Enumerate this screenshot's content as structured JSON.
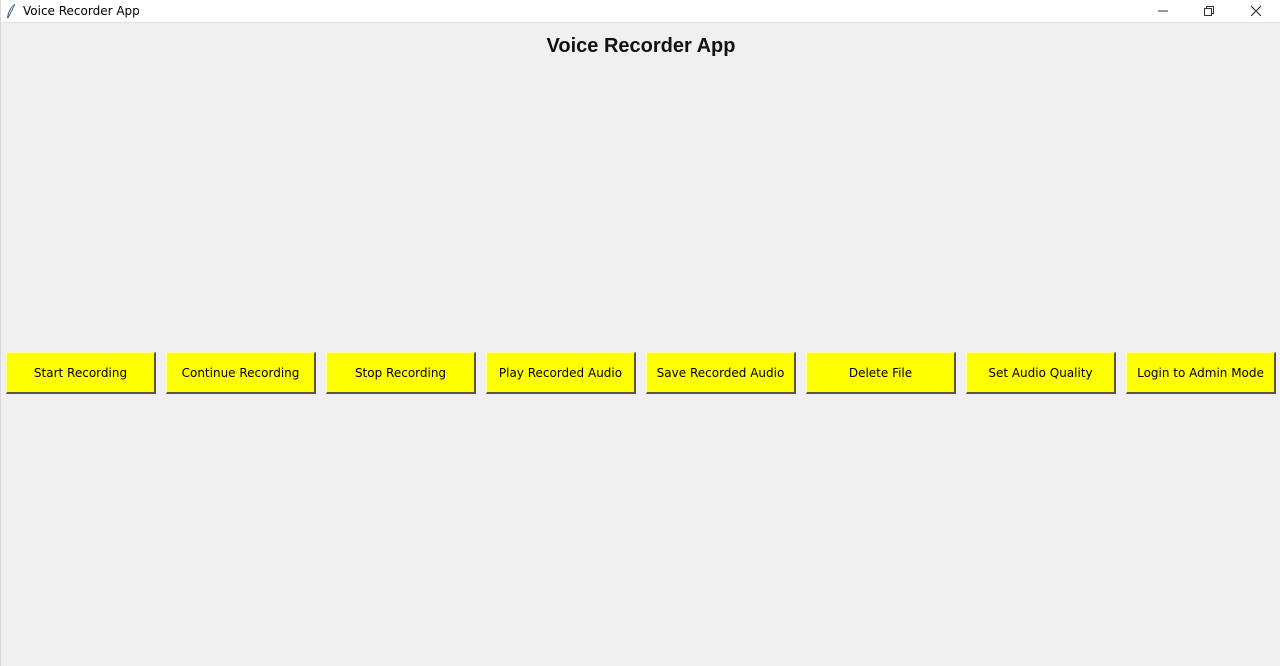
{
  "window": {
    "title": "Voice Recorder App",
    "app_icon": "feather-icon",
    "controls": {
      "minimize": "minimize-icon",
      "maximize": "restore-icon",
      "close": "close-icon"
    }
  },
  "main": {
    "heading": "Voice Recorder App",
    "buttons": [
      {
        "label": "Start Recording"
      },
      {
        "label": "Continue Recording"
      },
      {
        "label": "Stop Recording"
      },
      {
        "label": "Play Recorded Audio"
      },
      {
        "label": "Save Recorded Audio"
      },
      {
        "label": "Delete File"
      },
      {
        "label": "Set Audio Quality"
      },
      {
        "label": "Login to Admin Mode"
      }
    ],
    "button_color": "#ffff00"
  }
}
